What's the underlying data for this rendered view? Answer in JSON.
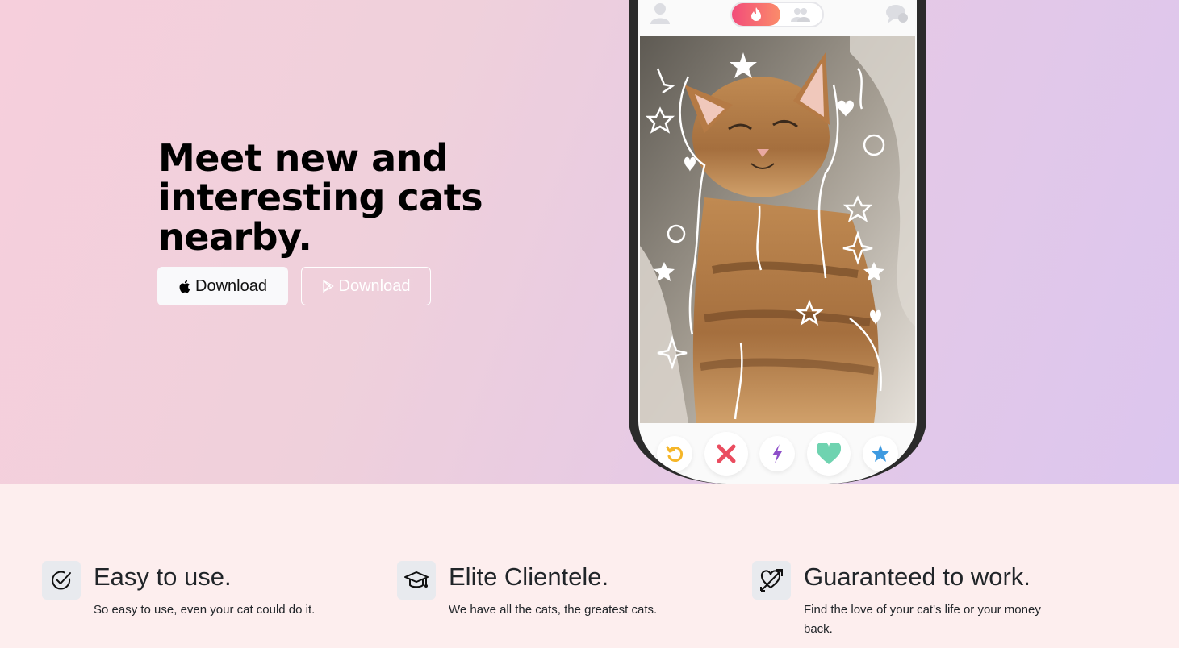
{
  "hero": {
    "title": "Meet new and interesting cats nearby.",
    "download_apple_label": "Download",
    "download_play_label": "Download"
  },
  "phone": {
    "top_icons": [
      "profile-icon",
      "flame-icon",
      "group-icon",
      "chat-icon"
    ],
    "actions": [
      "rewind-icon",
      "nope-icon",
      "boost-icon",
      "like-icon",
      "superlike-icon"
    ],
    "colors": {
      "rewind": "#f5b629",
      "nope": "#ea4c5f",
      "boost": "#8e4fc9",
      "like": "#6fd3b0",
      "superlike": "#3e9ae0",
      "toggle_gradient_start": "#f24c7a",
      "toggle_gradient_end": "#fb8c6a"
    }
  },
  "features": [
    {
      "icon": "check-circle-icon",
      "title": "Easy to use.",
      "description": "So easy to use, even your cat could do it."
    },
    {
      "icon": "graduation-cap-icon",
      "title": "Elite Clientele.",
      "description": "We have all the cats, the greatest cats."
    },
    {
      "icon": "heart-arrow-icon",
      "title": "Guaranteed to work.",
      "description": "Find the love of your cat's life or your money back."
    }
  ]
}
